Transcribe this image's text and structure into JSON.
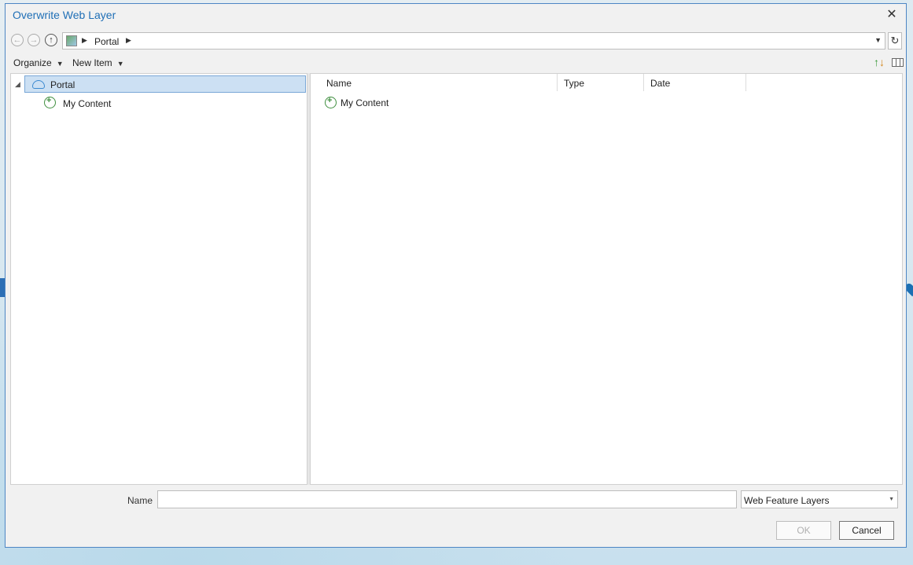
{
  "dialog": {
    "title": "Overwrite Web Layer",
    "close_glyph": "✕"
  },
  "nav": {
    "back_glyph": "←",
    "forward_glyph": "→",
    "up_glyph": "↑",
    "address_path": "Portal",
    "refresh_glyph": "↻"
  },
  "toolbar": {
    "organize_label": "Organize",
    "new_item_label": "New Item"
  },
  "tree": {
    "items": [
      {
        "label": "Portal",
        "selected": true,
        "icon": "cloud-icon"
      },
      {
        "label": "My Content",
        "selected": false,
        "icon": "my-content-icon"
      }
    ]
  },
  "list": {
    "columns": [
      "Name",
      "Type",
      "Date"
    ],
    "rows": [
      {
        "name": "My Content",
        "icon": "my-content-icon"
      }
    ]
  },
  "bottom": {
    "name_label": "Name",
    "name_value": "",
    "filter_value": "Web Feature Layers",
    "ok_label": "OK",
    "cancel_label": "Cancel"
  },
  "colors": {
    "title": "#1f6fb6",
    "selection": "#cce0f3",
    "border_accent": "#4d86c4"
  }
}
